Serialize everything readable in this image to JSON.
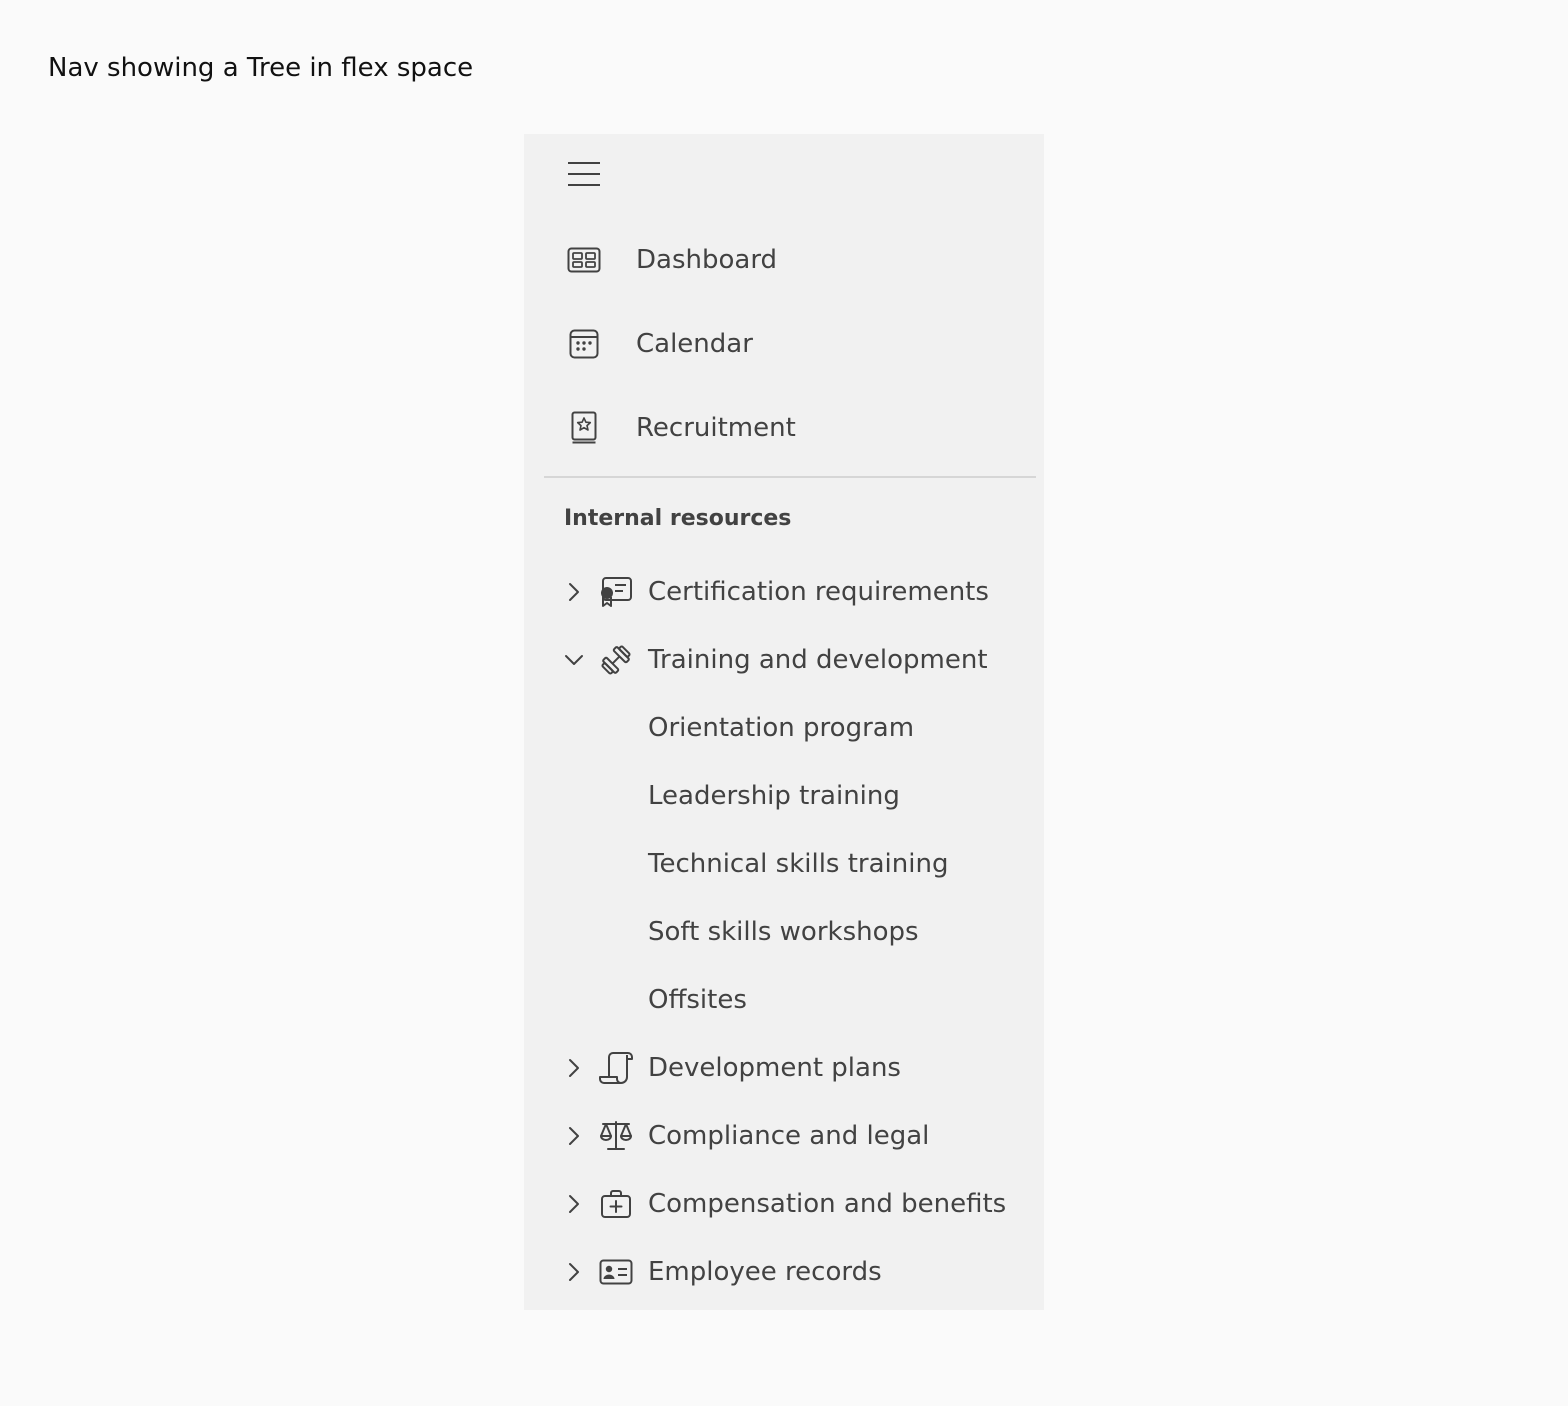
{
  "page": {
    "title": "Nav showing a Tree in flex space"
  },
  "nav": {
    "menu_icon": "hamburger-icon",
    "items": [
      {
        "label": "Dashboard",
        "icon": "dashboard-icon"
      },
      {
        "label": "Calendar",
        "icon": "calendar-icon"
      },
      {
        "label": "Recruitment",
        "icon": "recruitment-icon"
      }
    ],
    "section_header": "Internal resources",
    "tree": [
      {
        "label": "Certification requirements",
        "icon": "certificate-icon",
        "expanded": false
      },
      {
        "label": "Training and development",
        "icon": "dumbbell-icon",
        "expanded": true,
        "children": [
          {
            "label": "Orientation program"
          },
          {
            "label": "Leadership training"
          },
          {
            "label": "Technical skills training"
          },
          {
            "label": "Soft skills workshops"
          },
          {
            "label": "Offsites"
          }
        ]
      },
      {
        "label": "Development plans",
        "icon": "scroll-icon",
        "expanded": false
      },
      {
        "label": "Compliance and legal",
        "icon": "scales-icon",
        "expanded": false
      },
      {
        "label": "Compensation and benefits",
        "icon": "briefcase-medical-icon",
        "expanded": false
      },
      {
        "label": "Employee records",
        "icon": "contact-card-icon",
        "expanded": false
      }
    ]
  },
  "colors": {
    "page_background": "#fafafa",
    "nav_background": "#f1f1f1",
    "text": "#424242",
    "divider": "#d6d6d6"
  }
}
